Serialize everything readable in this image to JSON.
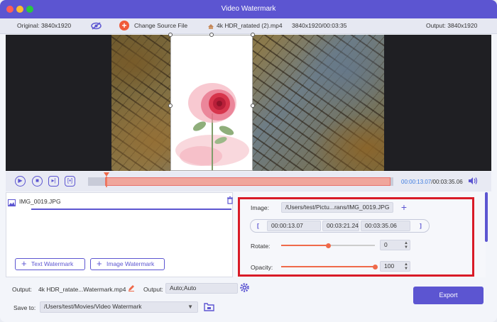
{
  "window": {
    "title": "Video Watermark"
  },
  "infobar": {
    "original": "Original: 3840x1920",
    "change_source": "Change Source File",
    "file_name": "4k HDR_ratated (2).mp4",
    "file_meta": "3840x1920/00:03:35",
    "output": "Output: 3840x1920"
  },
  "player": {
    "time_current": "00:00:13.07",
    "time_total": "/00:03:35.06",
    "progress_fraction": 0.06
  },
  "watermark_list": {
    "items": [
      {
        "name": "IMG_0019.JPG"
      }
    ],
    "text_watermark_label": "Text Watermark",
    "image_watermark_label": "Image Watermark"
  },
  "settings": {
    "image_label": "Image:",
    "image_path": "/Users/test/Pictu...rans/IMG_0019.JPG",
    "start_time": "00:00:13.07",
    "duration": "00:03:21.24",
    "end_time": "00:03:35.06",
    "rotate_label": "Rotate:",
    "rotate_value": "0",
    "rotate_fraction": 0.5,
    "opacity_label": "Opacity:",
    "opacity_value": "100",
    "opacity_fraction": 1.0
  },
  "footer": {
    "output_label": "Output:",
    "output_file": "4k HDR_ratate...Watermark.mp4",
    "output_format_label": "Output:",
    "output_format": "Auto;Auto",
    "save_to_label": "Save to:",
    "save_path": "/Users/test/Movies/Video Watermark",
    "export_label": "Export"
  },
  "colors": {
    "accent": "#5c55d1",
    "highlight": "#d91b27",
    "orange": "#f05a3a"
  }
}
